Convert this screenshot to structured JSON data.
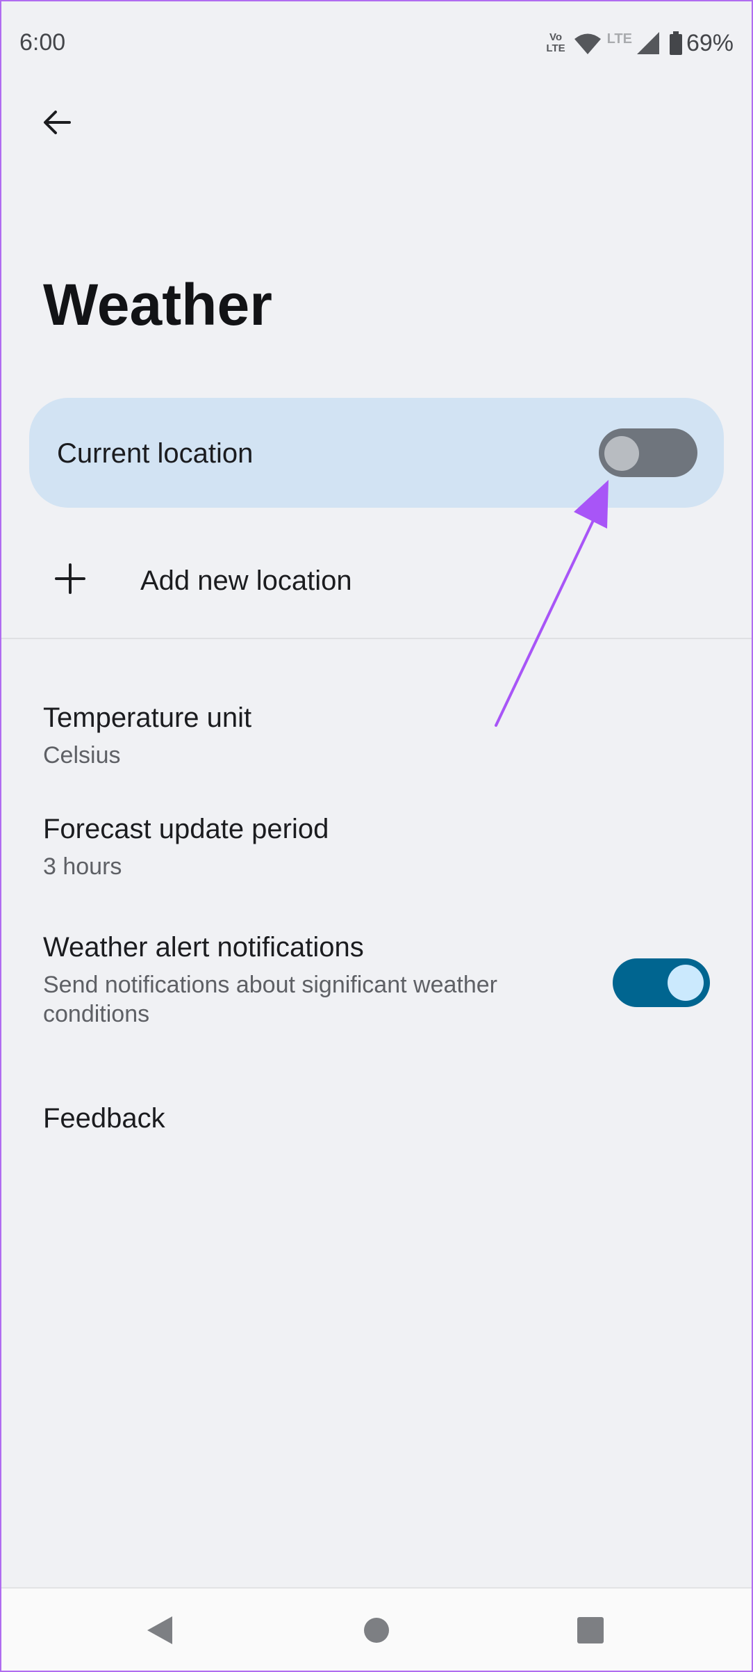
{
  "status_bar": {
    "time": "6:00",
    "volte_top": "Vo",
    "volte_bottom": "LTE",
    "lte": "LTE",
    "battery": "69%"
  },
  "header": {
    "title": "Weather"
  },
  "locations": {
    "current_label": "Current location",
    "current_enabled": false,
    "add_label": "Add new location"
  },
  "settings": {
    "temperature": {
      "title": "Temperature unit",
      "value": "Celsius"
    },
    "forecast": {
      "title": "Forecast update period",
      "value": "3 hours"
    },
    "alerts": {
      "title": "Weather alert notifications",
      "description": "Send notifications about significant weather conditions",
      "enabled": true
    },
    "feedback": {
      "title": "Feedback"
    }
  },
  "colors": {
    "accent": "#006590",
    "card": "#d2e3f3",
    "annotation": "#a855f7",
    "background": "#f0f1f4"
  },
  "icons": [
    "back-arrow-icon",
    "plus-icon",
    "wifi-icon",
    "signal-icon",
    "battery-icon",
    "nav-back-icon",
    "nav-home-icon",
    "nav-recents-icon"
  ]
}
